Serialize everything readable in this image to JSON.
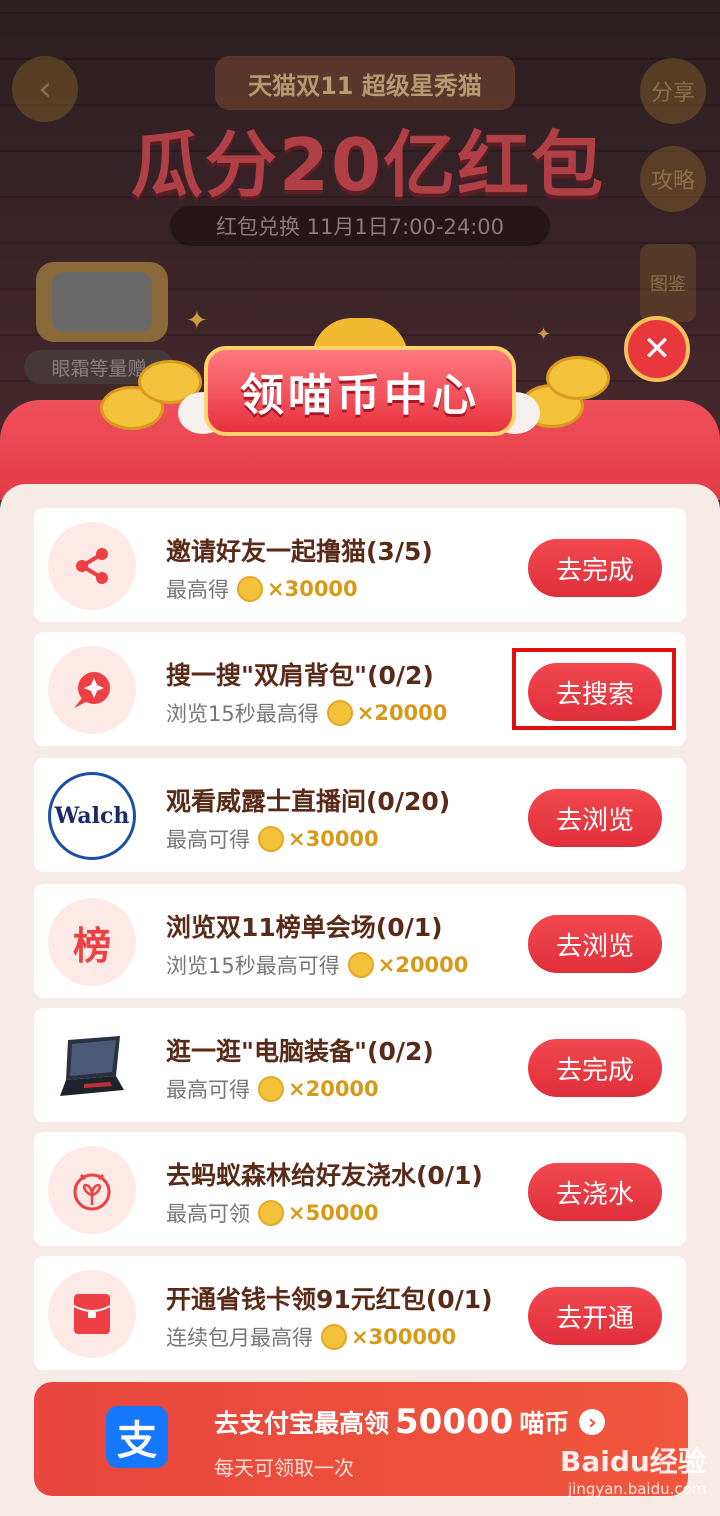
{
  "top": {
    "share_label": "分享",
    "guide_label": "攻略",
    "guide2_label": "图鉴",
    "event_title": "天猫双11 超级星秀猫",
    "headline": "瓜分20亿红包",
    "subline": "红包兑换 11月1日7:00-24:00",
    "tv_label": "眼霜等量赠"
  },
  "banner": {
    "title": "领喵币中心"
  },
  "tasks": [
    {
      "title": "邀请好友一起撸猫(3/5)",
      "sub": "最高得",
      "reward": "×30000",
      "button": "去完成",
      "icon": "share-icon"
    },
    {
      "title": "搜一搜\"双肩背包\"(0/2)",
      "sub": "浏览15秒最高得",
      "reward": "×20000",
      "button": "去搜索",
      "icon": "search-icon"
    },
    {
      "title": "观看威露士直播间(0/20)",
      "sub": "最高可得",
      "reward": "×30000",
      "button": "去浏览",
      "icon": "walch-logo-icon",
      "logo_text": "Walch"
    },
    {
      "title": "浏览双11榜单会场(0/1)",
      "sub": "浏览15秒最高可得",
      "reward": "×20000",
      "button": "去浏览",
      "icon": "ranking-icon",
      "logo_text": "榜"
    },
    {
      "title": "逛一逛\"电脑装备\"(0/2)",
      "sub": "最高可得",
      "reward": "×20000",
      "button": "去完成",
      "icon": "laptop-icon"
    },
    {
      "title": "去蚂蚁森林给好友浇水(0/1)",
      "sub": "最高可领",
      "reward": "×50000",
      "button": "去浇水",
      "icon": "sprout-icon"
    },
    {
      "title": "开通省钱卡领91元红包(0/1)",
      "sub": "连续包月最高得",
      "reward": "×300000",
      "button": "去开通",
      "icon": "red-envelope-icon"
    }
  ],
  "alipay": {
    "logo": "支",
    "title_pre": "去支付宝最高领",
    "title_amount": "50000",
    "title_post": "喵币",
    "sub": "每天可领取一次"
  },
  "watermark": {
    "brand": "Baidu经验",
    "url": "jingyan.baidu.com"
  },
  "colors": {
    "accent": "#e8313f",
    "coin": "#f4c23a",
    "reward": "#d69a18"
  }
}
